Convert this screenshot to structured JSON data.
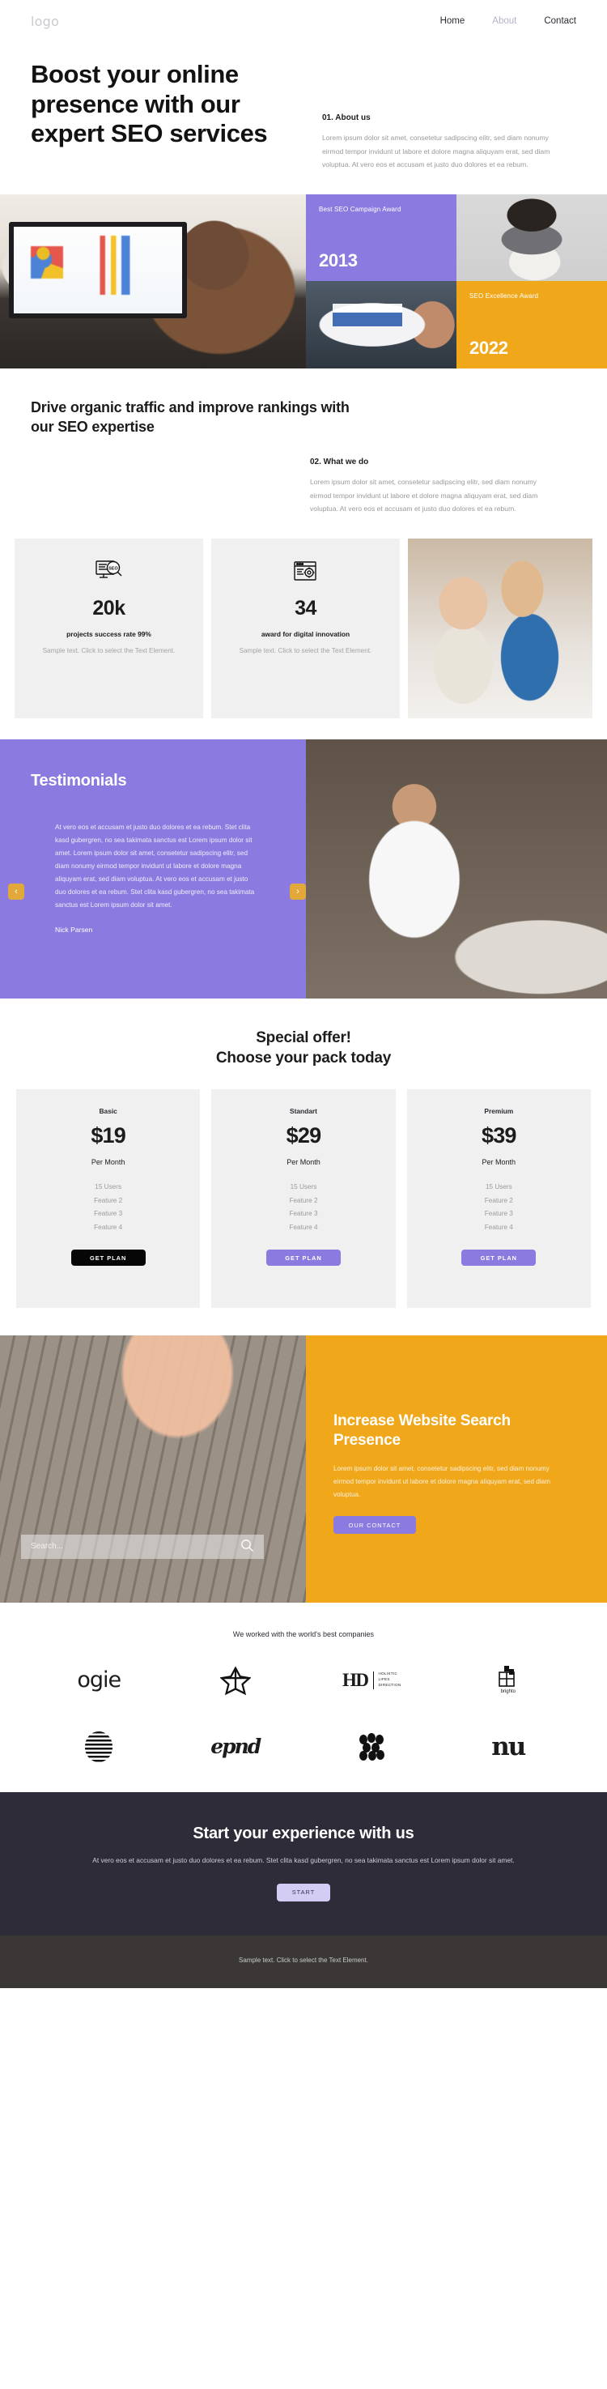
{
  "header": {
    "logo": "logo",
    "nav": [
      {
        "label": "Home",
        "muted": false
      },
      {
        "label": "About",
        "muted": true
      },
      {
        "label": "Contact",
        "muted": false
      }
    ]
  },
  "hero": {
    "title": "Boost your online presence with our expert SEO services",
    "eyebrow": "01. About us",
    "body": "Lorem ipsum dolor sit amet, consetetur sadipscing elitr, sed diam nonumy eirmod tempor invidunt ut labore et dolore magna aliquyam erat, sed diam voluptua. At vero eos et accusam et justo duo dolores et ea rebum."
  },
  "awards": {
    "campaign": {
      "label": "Best SEO Campaign Award",
      "year": "2013",
      "color": "#8b7be0"
    },
    "excellence": {
      "label": "SEO Excellence Award",
      "year": "2022",
      "color": "#f0a81a"
    },
    "photos": [
      {
        "name": "woman-pointing-at-charts-photo"
      },
      {
        "name": "fashion-model-photo"
      },
      {
        "name": "tablet-analytics-photo"
      }
    ]
  },
  "what_we_do": {
    "title": "Drive organic traffic and improve rankings with our SEO expertise",
    "eyebrow": "02. What we do",
    "body": "Lorem ipsum dolor sit amet, consetetur sadipscing elitr, sed diam nonumy eirmod tempor invidunt ut labore et dolore magna aliquyam erat, sed diam voluptua. At vero eos et accusam et justo duo dolores et ea rebum."
  },
  "stats": [
    {
      "icon": "seo-monitor-magnifier-icon",
      "value": "20k",
      "label": "projects success rate 99%",
      "note": "Sample text. Click to select the Text Element."
    },
    {
      "icon": "browser-gear-icon",
      "value": "34",
      "label": "award for digital innovation",
      "note": "Sample text. Click to select the Text Element."
    }
  ],
  "stats_photo": "team-with-laptop-photo",
  "testimonials": {
    "title": "Testimonials",
    "quote": "At vero eos et accusam et justo duo dolores et ea rebum. Stet clita kasd gubergren, no sea takimata sanctus est Lorem ipsum dolor sit amet. Lorem ipsum dolor sit amet, consetetur sadipscing elitr, sed diam nonumy eirmod tempor invidunt ut labore et dolore magna aliquyam erat, sed diam voluptua. At vero eos et accusam et justo duo dolores et ea rebum. Stet clita kasd gubergren, no sea takimata sanctus est Lorem ipsum dolor sit amet.",
    "author": "Nick Parsen",
    "prev": "‹",
    "next": "›",
    "background": "#8b7be0",
    "arrow_color": "#e2a93a",
    "photo": "man-in-office-photo"
  },
  "pricing": {
    "title_line1": "Special offer!",
    "title_line2": "Choose your pack today",
    "plans": [
      {
        "name": "Basic",
        "price": "$19",
        "period": "Per Month",
        "features": [
          "15 Users",
          "Feature 2",
          "Feature 3",
          "Feature 4"
        ],
        "cta": "GET PLAN",
        "cta_color": "#060606"
      },
      {
        "name": "Standart",
        "price": "$29",
        "period": "Per Month",
        "features": [
          "15 Users",
          "Feature 2",
          "Feature 3",
          "Feature 4"
        ],
        "cta": "GET PLAN",
        "cta_color": "#8b7be0"
      },
      {
        "name": "Premium",
        "price": "$39",
        "period": "Per Month",
        "features": [
          "15 Users",
          "Feature 2",
          "Feature 3",
          "Feature 4"
        ],
        "cta": "GET PLAN",
        "cta_color": "#8b7be0"
      }
    ]
  },
  "banner": {
    "photo": "hands-typing-on-keyboard-photo",
    "search_placeholder": "Search...",
    "search_value": "",
    "search_icon": "search-icon",
    "title": "Increase Website Search Presence",
    "body": "Lorem ipsum dolor sit amet, consetetur sadipscing elitr, sed diam nonumy eirmod tempor invidunt ut labore et dolore magna aliquyam erat, sed diam voluptua.",
    "cta": "OUR CONTACT",
    "background": "#f0a81a",
    "cta_color": "#8b7be0"
  },
  "clients": {
    "title": "We worked with the world's best companies",
    "logos": [
      {
        "name": "ogie-logo",
        "text": "ogie",
        "type": "wordmark"
      },
      {
        "name": "flower-logo",
        "text": "",
        "type": "flower"
      },
      {
        "name": "hd-holistic-lifes-direction-logo",
        "text": "HD",
        "sub": "HOLISTIC LIFES DIRECTION",
        "type": "hd"
      },
      {
        "name": "brighto-logo",
        "text": "brighto",
        "type": "brighto"
      },
      {
        "name": "striped-circle-logo",
        "text": "",
        "type": "stripes"
      },
      {
        "name": "epnd-logo",
        "text": "epnd",
        "type": "script"
      },
      {
        "name": "dots-cluster-logo",
        "text": "",
        "type": "dots"
      },
      {
        "name": "nu-logo",
        "text": "nu",
        "type": "serif"
      }
    ]
  },
  "final_cta": {
    "title": "Start your experience with us",
    "body": "At vero eos et accusam et justo duo dolores et ea rebum. Stet clita kasd gubergren, no sea takimata sanctus est Lorem ipsum dolor sit amet.",
    "cta": "START",
    "background": "#2e2c39",
    "cta_color": "#d3cdf4"
  },
  "footer": {
    "text": "Sample text. Click to select the Text Element.",
    "background": "#3a3736"
  }
}
